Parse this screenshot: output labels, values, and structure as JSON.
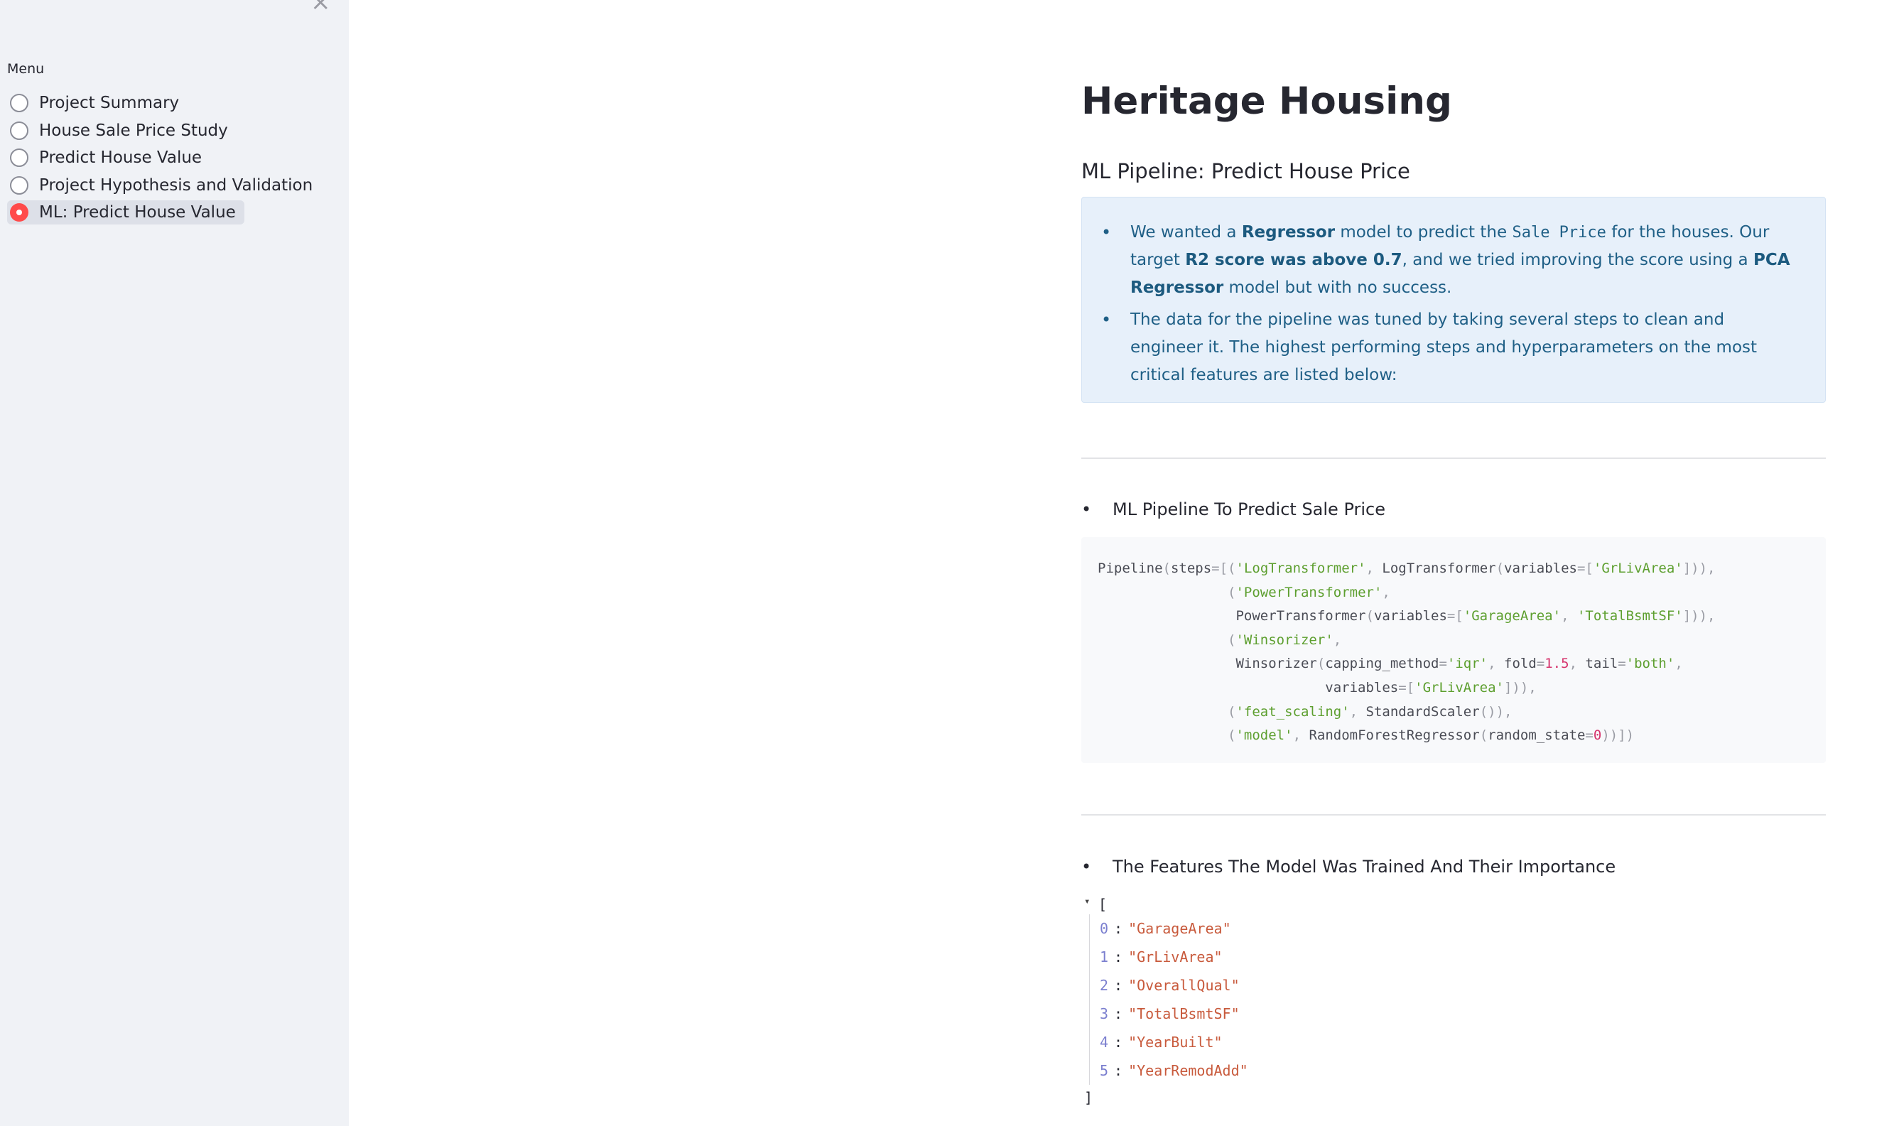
{
  "sidebar": {
    "close_glyph": "×",
    "menu_label": "Menu",
    "items": [
      {
        "label": "Project Summary",
        "selected": false
      },
      {
        "label": "House Sale Price Study",
        "selected": false
      },
      {
        "label": "Predict House Value",
        "selected": false
      },
      {
        "label": "Project Hypothesis and Validation",
        "selected": false
      },
      {
        "label": "ML: Predict House Value",
        "selected": true
      }
    ],
    "selected_color": "#ff4b4b"
  },
  "main": {
    "title": "Heritage Housing",
    "subtitle": "ML Pipeline: Predict House Price",
    "info": {
      "b1_t1": "We wanted a ",
      "b1_b1": "Regressor",
      "b1_t2": " model to predict the ",
      "b1_code": "Sale Price",
      "b1_t3": " for the houses. Our target ",
      "b1_b2": "R2 score was above 0.7",
      "b1_t4": ", and we tried improving the score using a ",
      "b1_b3": "PCA Regressor",
      "b1_t5": " model but with no success.",
      "b2": "The data for the pipeline was tuned by taking several steps to clean and engineer it. The highest performing steps and hyperparameters on the most critical features are listed below:"
    },
    "pipeline_heading": "ML Pipeline To Predict Sale Price",
    "features_heading": "The Features The Model Was Trained And Their Importance",
    "features": [
      "GarageArea",
      "GrLivArea",
      "OverallQual",
      "TotalBsmtSF",
      "YearBuilt",
      "YearRemodAdd"
    ],
    "info_bg": "#e7f0fa"
  }
}
